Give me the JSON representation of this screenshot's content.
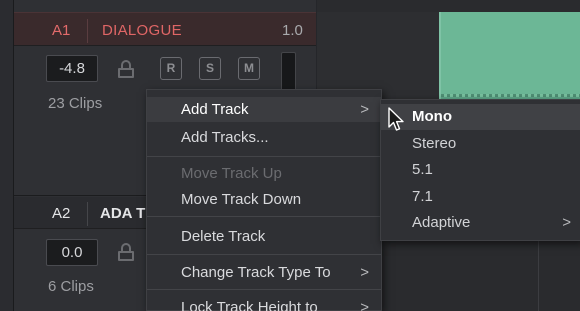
{
  "tracks": {
    "a1": {
      "id": "A1",
      "name": "DIALOGUE",
      "level": "1.0",
      "volume": "-4.8",
      "buttons": [
        "R",
        "S",
        "M"
      ],
      "clips": "23 Clips"
    },
    "a2": {
      "id": "A2",
      "name": "ADA T",
      "volume": "0.0",
      "clips": "6 Clips"
    }
  },
  "context_menu": {
    "items": [
      {
        "label": "Add Track",
        "chevron": ">"
      },
      {
        "label": "Add Tracks..."
      },
      {
        "label": "Move Track Up"
      },
      {
        "label": "Move Track Down"
      },
      {
        "label": "Delete Track"
      },
      {
        "label": "Change Track Type To",
        "chevron": ">"
      },
      {
        "label": "Lock Track Height to",
        "chevron": ">"
      }
    ]
  },
  "submenu": {
    "items": [
      {
        "label": "Mono"
      },
      {
        "label": "Stereo"
      },
      {
        "label": "5.1"
      },
      {
        "label": "7.1"
      },
      {
        "label": "Adaptive",
        "chevron": ">"
      }
    ]
  },
  "colors": {
    "track_accent": "#e06666",
    "clip_green": "#5ea88a",
    "menu_bg": "#2f3034"
  }
}
